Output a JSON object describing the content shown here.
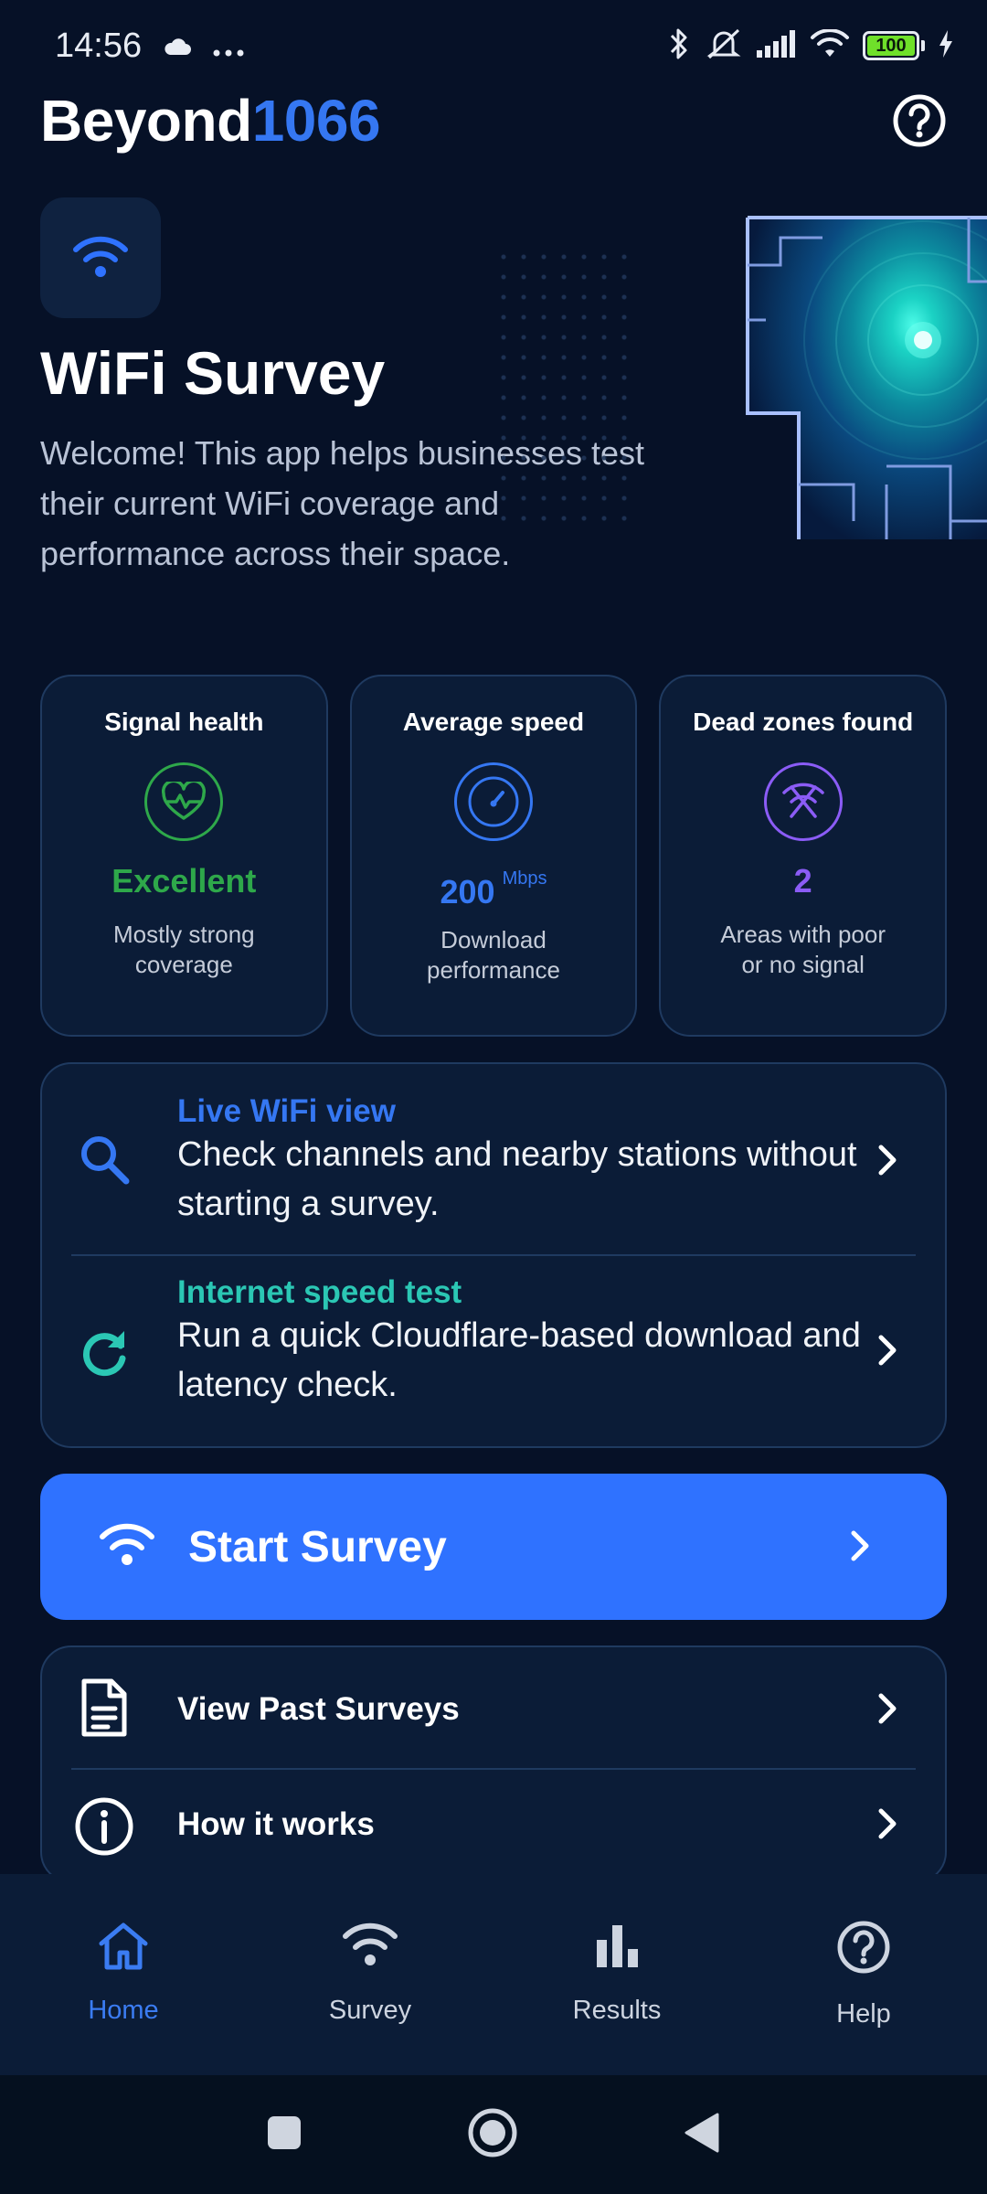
{
  "status_bar": {
    "time": "14:56",
    "battery": "100",
    "icons": [
      "cloud-icon",
      "more-icon",
      "bluetooth-icon",
      "muted-icon",
      "cellular-signal-icon",
      "wifi-icon",
      "battery-icon",
      "charging-icon"
    ]
  },
  "header": {
    "brand_main": "Beyond",
    "brand_accent": "1066",
    "help_icon": "help-circle-icon"
  },
  "hero": {
    "icon": "wifi-icon",
    "title": "WiFi Survey",
    "description": "Welcome! This app helps businesses test their current WiFi coverage and performance across their space."
  },
  "stats": [
    {
      "title": "Signal health",
      "icon": "heart-pulse-icon",
      "value": "Excellent",
      "unit": "",
      "subtitle": "Mostly strong coverage",
      "color": "#2ea84a"
    },
    {
      "title": "Average speed",
      "icon": "speedometer-icon",
      "value": "200",
      "unit": "Mbps",
      "subtitle": "Download performance",
      "color": "#3577f2"
    },
    {
      "title": "Dead zones found",
      "icon": "no-signal-icon",
      "value": "2",
      "unit": "",
      "subtitle": "Areas with poor or no signal",
      "color": "#8b5cf6"
    }
  ],
  "tools": [
    {
      "kicker": "Live WiFi view",
      "description": "Check channels and nearby stations without starting a survey.",
      "icon": "search-icon",
      "color": "#3577f2"
    },
    {
      "kicker": "Internet speed test",
      "description": "Run a quick Cloudflare-based download and latency check.",
      "icon": "refresh-icon",
      "color": "#2bc7b4"
    }
  ],
  "primary_action": {
    "label": "Start Survey",
    "icon": "wifi-icon"
  },
  "secondary_actions": [
    {
      "label": "View Past Surveys",
      "icon": "document-icon"
    },
    {
      "label": "How it works",
      "icon": "info-icon"
    }
  ],
  "bottom_nav": [
    {
      "label": "Home",
      "icon": "home-icon",
      "active": true
    },
    {
      "label": "Survey",
      "icon": "wifi-icon",
      "active": false
    },
    {
      "label": "Results",
      "icon": "bar-chart-icon",
      "active": false
    },
    {
      "label": "Help",
      "icon": "help-circle-icon",
      "active": false
    }
  ],
  "colors": {
    "background": "#061127",
    "card": "#0b1c37",
    "accent": "#2f72ff"
  }
}
